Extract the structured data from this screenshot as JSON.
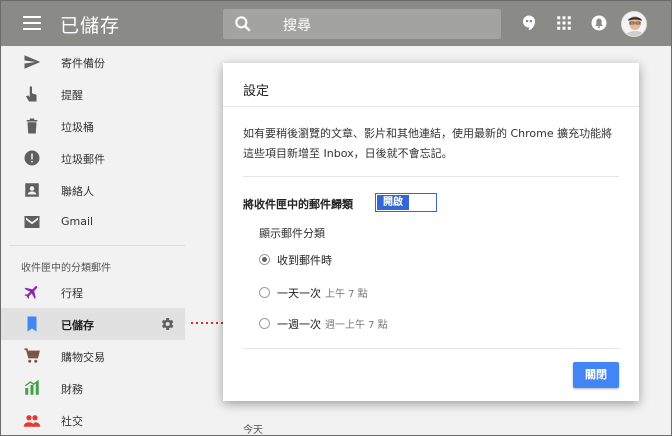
{
  "header": {
    "menu_icon": "hamburger-icon",
    "title": "已儲存",
    "search_placeholder": "搜尋",
    "icons": [
      "hangouts-icon",
      "apps-grid-icon",
      "notifications-bell-icon",
      "avatar"
    ]
  },
  "sidebar": {
    "items": [
      {
        "label": "寄件備份",
        "icon": "send-icon"
      },
      {
        "label": "提醒",
        "icon": "reminder-hand-icon"
      },
      {
        "label": "垃圾桶",
        "icon": "trash-icon"
      },
      {
        "label": "垃圾郵件",
        "icon": "spam-icon"
      },
      {
        "label": "聯絡人",
        "icon": "contacts-icon"
      },
      {
        "label": "Gmail",
        "icon": "gmail-icon"
      }
    ],
    "section_label": "收件匣中的分類郵件",
    "bundles": [
      {
        "label": "行程",
        "icon": "plane-icon",
        "color": "#8e24aa"
      },
      {
        "label": "已儲存",
        "icon": "bookmark-icon",
        "color": "#4285f4",
        "active": true
      },
      {
        "label": "購物交易",
        "icon": "cart-icon",
        "color": "#795548"
      },
      {
        "label": "財務",
        "icon": "finance-icon",
        "color": "#43a047"
      },
      {
        "label": "社交",
        "icon": "social-icon",
        "color": "#e53935"
      }
    ]
  },
  "dialog": {
    "title": "設定",
    "description": "如有要稍後瀏覽的文章、影片和其他連結，使用最新的 Chrome 擴充功能將這些項目新增至 Inbox，日後就不會忘記。",
    "toggle_label": "將收件匣中的郵件歸類",
    "toggle_value": "開啟",
    "subheading": "顯示郵件分類",
    "options": [
      {
        "label": "收到郵件時",
        "hint": "",
        "checked": true
      },
      {
        "label": "一天一次",
        "hint": "上午 7 點",
        "checked": false
      },
      {
        "label": "一週一次",
        "hint": "週一上午 7 點",
        "checked": false
      }
    ],
    "close_button": "關閉"
  },
  "main": {
    "section_today": "今天"
  },
  "colors": {
    "header_bg": "#8a8a86",
    "accent": "#4285f4",
    "arrow": "#d32f2f"
  }
}
